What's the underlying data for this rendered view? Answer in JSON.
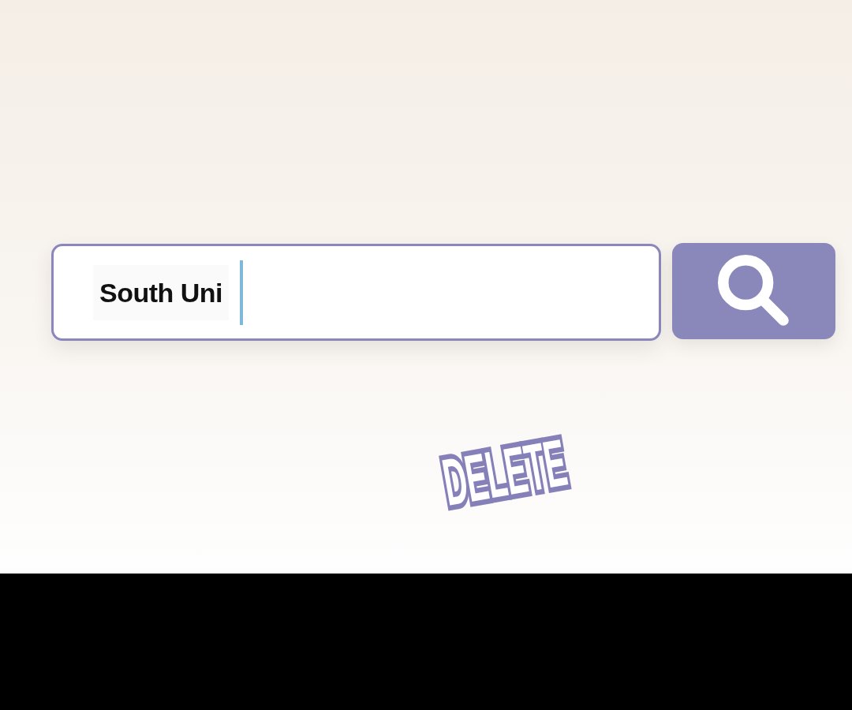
{
  "search": {
    "value": "South Uni",
    "focused": true
  },
  "sticker": {
    "text": "DELETE"
  }
}
